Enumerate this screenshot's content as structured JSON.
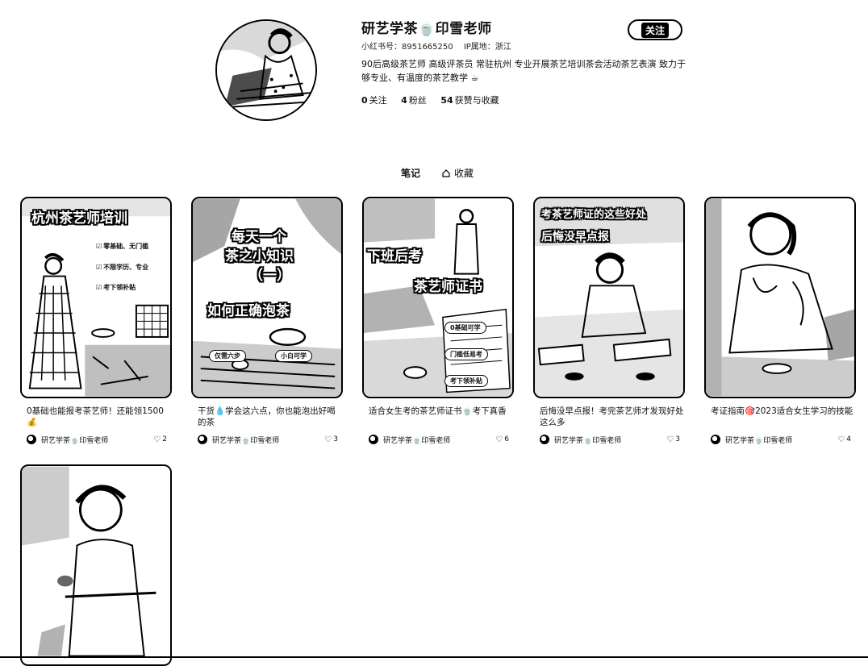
{
  "profile": {
    "name": "研艺学茶🍵印雪老师",
    "xhs_id": "小红书号：8951665250",
    "ip": "IP属地：浙江",
    "bio": "90后高级茶艺师 高级评茶员 常驻杭州 专业开展茶艺培训茶会活动茶艺表演 致力于够专业、有温度的茶艺教学 ☕",
    "follow_label": "关注",
    "stats": [
      {
        "value": "0",
        "label": "关注"
      },
      {
        "value": "4",
        "label": "粉丝"
      },
      {
        "value": "54",
        "label": "获赞与收藏"
      }
    ]
  },
  "tabs": {
    "notes": "笔记",
    "favorites": "收藏"
  },
  "notes": [
    {
      "title": "0基础也能报考茶艺师！还能领1500💰",
      "author": "研艺学茶🍵印雪老师",
      "likes": "2",
      "cover": {
        "headline": "杭州茶艺师培训",
        "items": [
          "零基础、无门槛",
          "不限学历、专业",
          "考下领补贴"
        ]
      }
    },
    {
      "title": "干货💧学会这六点，你也能泡出好喝的茶",
      "author": "研艺学茶🍵印雪老师",
      "likes": "3",
      "cover": {
        "headline_lines": [
          "每天一个",
          "茶之小知识",
          "（一）",
          "如何正确泡茶"
        ],
        "pills": [
          "仅需六步",
          "小白可学"
        ]
      }
    },
    {
      "title": "适合女生考的茶艺师证书🍵考下真香",
      "author": "研艺学茶🍵印雪老师",
      "likes": "6",
      "cover": {
        "headline_lines": [
          "下班后考",
          "茶艺师证书"
        ],
        "pills": [
          "0基础可学",
          "门槛低易考",
          "考下领补贴"
        ]
      }
    },
    {
      "title": "后悔没早点报！考完茶艺师才发现好处这么多",
      "author": "研艺学茶🍵印雪老师",
      "likes": "3",
      "cover": {
        "headline_lines": [
          "考茶艺师证的这些好处",
          "后悔没早点报"
        ]
      }
    },
    {
      "title": "考证指南🎯2023适合女生学习的技能",
      "author": "研艺学茶🍵印雪老师",
      "likes": "4",
      "cover": {}
    },
    {
      "title": "",
      "author": "",
      "likes": "",
      "cover": {}
    }
  ],
  "icons": {
    "tab_favorites": "house-icon",
    "likes": "heart-icon"
  }
}
